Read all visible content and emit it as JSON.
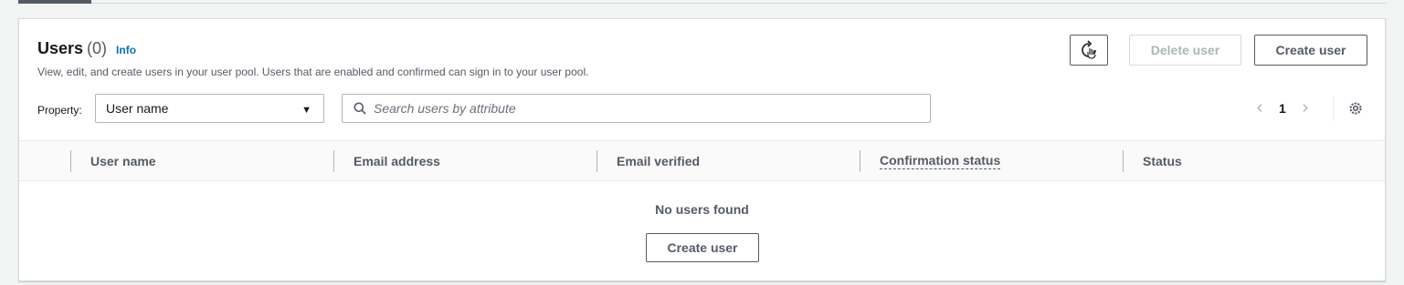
{
  "users_panel": {
    "title": "Users",
    "count": "(0)",
    "info_link": "Info",
    "description": "View, edit, and create users in your user pool. Users that are enabled and confirmed can sign in to your user pool.",
    "actions": {
      "refresh_icon": "refresh-cursor-icon",
      "delete_label": "Delete user",
      "create_label": "Create user"
    },
    "filter": {
      "property_label": "Property:",
      "property_value": "User name",
      "search_placeholder": "Search users by attribute"
    },
    "pagination": {
      "current_page": "1",
      "prev_icon": "chevron-left-icon",
      "next_icon": "chevron-right-icon",
      "settings_icon": "gear-icon"
    },
    "table": {
      "columns": [
        "User name",
        "Email address",
        "Email verified",
        "Confirmation status",
        "Status"
      ],
      "empty_text": "No users found",
      "empty_create_label": "Create user"
    }
  },
  "colors": {
    "link": "#0073bb",
    "disabled": "#aab7b8",
    "border": "#545b64",
    "background": "#f2f3f3"
  }
}
